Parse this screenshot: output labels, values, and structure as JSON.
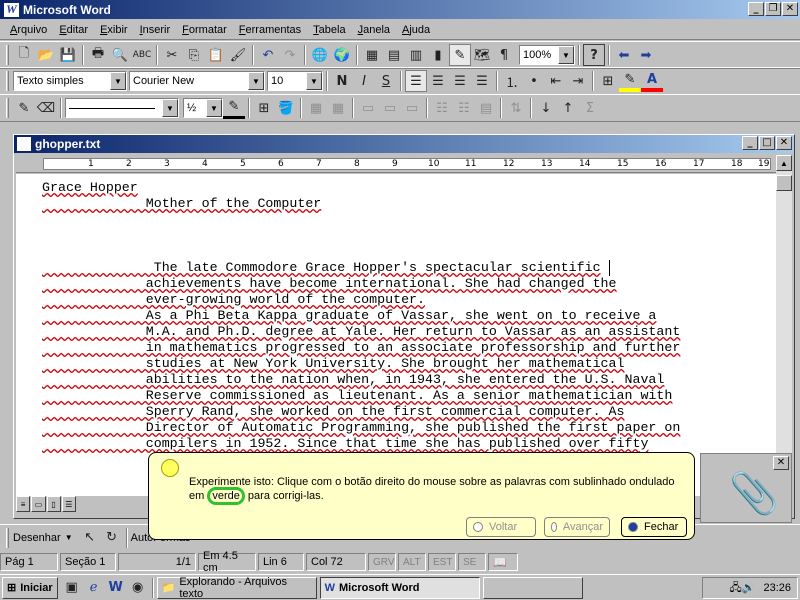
{
  "app": {
    "title": "Microsoft Word"
  },
  "menu": [
    "Arquivo",
    "Editar",
    "Exibir",
    "Inserir",
    "Formatar",
    "Ferramentas",
    "Tabela",
    "Janela",
    "Ajuda"
  ],
  "toolbar": {
    "zoom": "100%",
    "style": "Texto simples",
    "font": "Courier New",
    "size": "10",
    "bold": "N",
    "italic": "I",
    "underline": "S",
    "line_width": "½"
  },
  "document": {
    "window_title": "ghopper.txt",
    "lines": [
      "Grace Hopper",
      "             Mother of the Computer",
      "",
      "",
      "",
      "              The late Commodore Grace Hopper's spectacular scientific",
      "             achievements have become international. She had changed the",
      "             ever-growing world of the computer.",
      "             As a Phi Beta Kappa graduate of Vassar, she went on to receive a",
      "             M.A. and Ph.D. degree at Yale. Her return to Vassar as an assistant",
      "             in mathematics progressed to an associate professorship and further",
      "             studies at New York University. She brought her mathematical",
      "             abilities to the nation when, in 1943, she entered the U.S. Naval",
      "             Reserve commissioned as lieutenant. As a senior mathematician with",
      "             Sperry Rand, she worked on the first commercial computer. As",
      "             Director of Automatic Programming, she published the first paper on",
      "             compilers in 1952. Since that time she has published over fifty"
    ]
  },
  "ruler": {
    "numbers": [
      "1",
      "2",
      "3",
      "4",
      "5",
      "6",
      "7",
      "8",
      "9",
      "10",
      "11",
      "12",
      "13",
      "14",
      "15",
      "16",
      "17",
      "18",
      "19"
    ]
  },
  "drawing": {
    "label": "Desenhar",
    "autoshapes": "AutoFormas"
  },
  "status": {
    "page": "Pág 1",
    "section": "Seção 1",
    "pages": "1/1",
    "position": "Em  4.5 cm",
    "line": "Lin 6",
    "col": "Col 72",
    "rec": "GRV",
    "trk": "ALT",
    "ext": "EST",
    "ovr": "SE"
  },
  "balloon": {
    "text_a": "Experimente isto: Clique com o botão direito do mouse sobre as palavras com sublinhado ondulado em ",
    "highlight": "verde",
    "text_b": " para corrigi-las.",
    "back": "Voltar",
    "next": "Avançar",
    "close": "Fechar"
  },
  "taskbar": {
    "start": "Iniciar",
    "task1": "Explorando - Arquivos texto",
    "task2": "Microsoft Word",
    "clock": "23:26"
  }
}
